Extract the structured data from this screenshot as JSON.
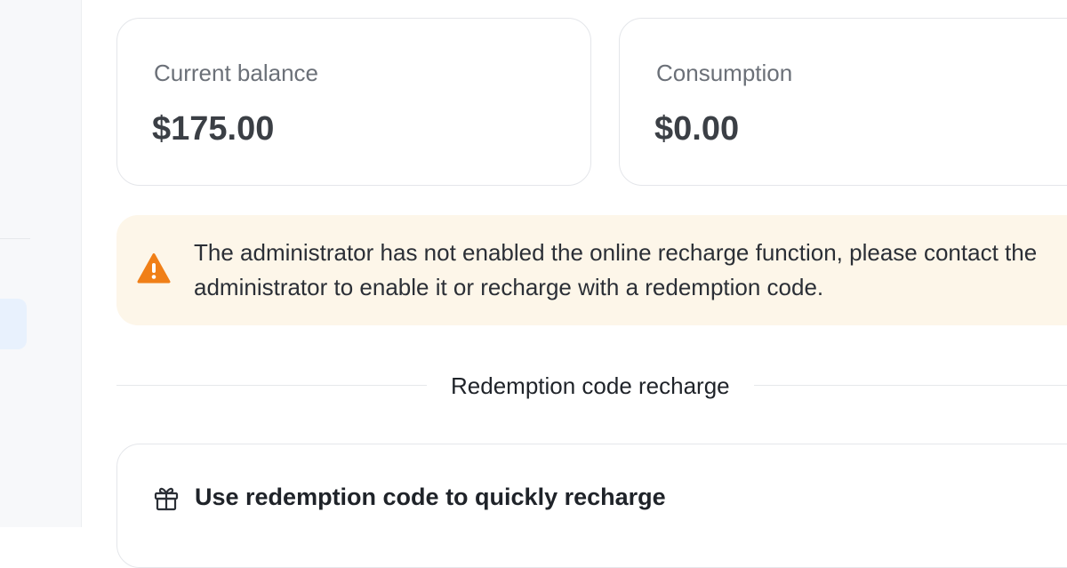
{
  "balance_card": {
    "label": "Current balance",
    "value": "$175.00"
  },
  "consumption_card": {
    "label": "Consumption",
    "value": "$0.00"
  },
  "alert": {
    "icon": "warning-icon",
    "icon_color": "#f07f17",
    "background": "#fdf6e9",
    "message": "The administrator has not enabled the online recharge function, please contact the administrator to enable it or recharge with a redemption code."
  },
  "section": {
    "title": "Redemption code recharge"
  },
  "redeem_card": {
    "icon": "gift-icon",
    "title": "Use redemption code to quickly recharge"
  }
}
